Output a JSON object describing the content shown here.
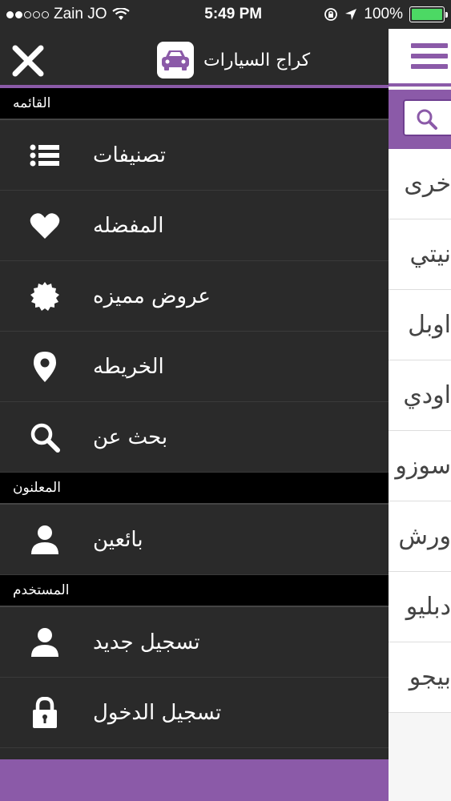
{
  "status": {
    "carrier": "Zain JO",
    "time": "5:49 PM",
    "battery": "100%",
    "battery_level": 1.0
  },
  "drawer": {
    "app_title": "كراج السيارات",
    "sections": [
      {
        "title": "القائمه",
        "items": [
          {
            "label": "تصنيفات",
            "icon": "list-icon"
          },
          {
            "label": "المفضله",
            "icon": "heart-icon"
          },
          {
            "label": "عروض مميزه",
            "icon": "badge-icon"
          },
          {
            "label": "الخريطه",
            "icon": "map-pin-icon"
          },
          {
            "label": "بحث عن",
            "icon": "search-icon"
          }
        ]
      },
      {
        "title": "المعلنون",
        "items": [
          {
            "label": "بائعين",
            "icon": "user-icon"
          }
        ]
      },
      {
        "title": "المستخدم",
        "items": [
          {
            "label": "تسجيل جديد",
            "icon": "user-icon"
          },
          {
            "label": "تسجيل الدخول",
            "icon": "lock-icon"
          }
        ]
      }
    ]
  },
  "main": {
    "list": [
      "خرى",
      "نيتي",
      "اوبل",
      "اودي",
      "سوزو",
      "ورش",
      "دبليو",
      "بيجو"
    ]
  },
  "colors": {
    "accent": "#8b5aa8",
    "drawer_bg": "#2a2a2a",
    "section_bg": "#000000"
  }
}
